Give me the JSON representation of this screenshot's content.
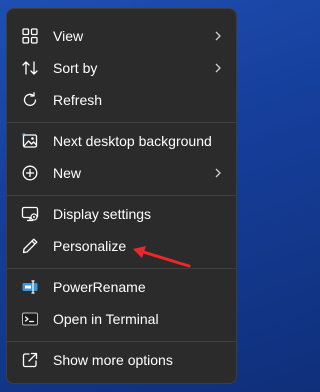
{
  "menu": {
    "items": [
      {
        "label": "View",
        "icon": "view-grid-icon",
        "submenu": true
      },
      {
        "label": "Sort by",
        "icon": "sort-icon",
        "submenu": true
      },
      {
        "label": "Refresh",
        "icon": "refresh-icon",
        "submenu": false
      },
      {
        "label": "Next desktop background",
        "icon": "desktop-background-icon",
        "submenu": false
      },
      {
        "label": "New",
        "icon": "plus-circle-icon",
        "submenu": true
      },
      {
        "label": "Display settings",
        "icon": "display-settings-icon",
        "submenu": false
      },
      {
        "label": "Personalize",
        "icon": "pen-icon",
        "submenu": false
      },
      {
        "label": "PowerRename",
        "icon": "powerrename-icon",
        "submenu": false
      },
      {
        "label": "Open in Terminal",
        "icon": "terminal-icon",
        "submenu": false
      },
      {
        "label": "Show more options",
        "icon": "external-open-icon",
        "submenu": false
      }
    ]
  },
  "colors": {
    "menu_bg": "#2b2b2b",
    "text": "#ffffff",
    "separator": "#3f3f3f",
    "annotation_arrow": "#e8282b",
    "desktop_bg": "#163f9c"
  }
}
